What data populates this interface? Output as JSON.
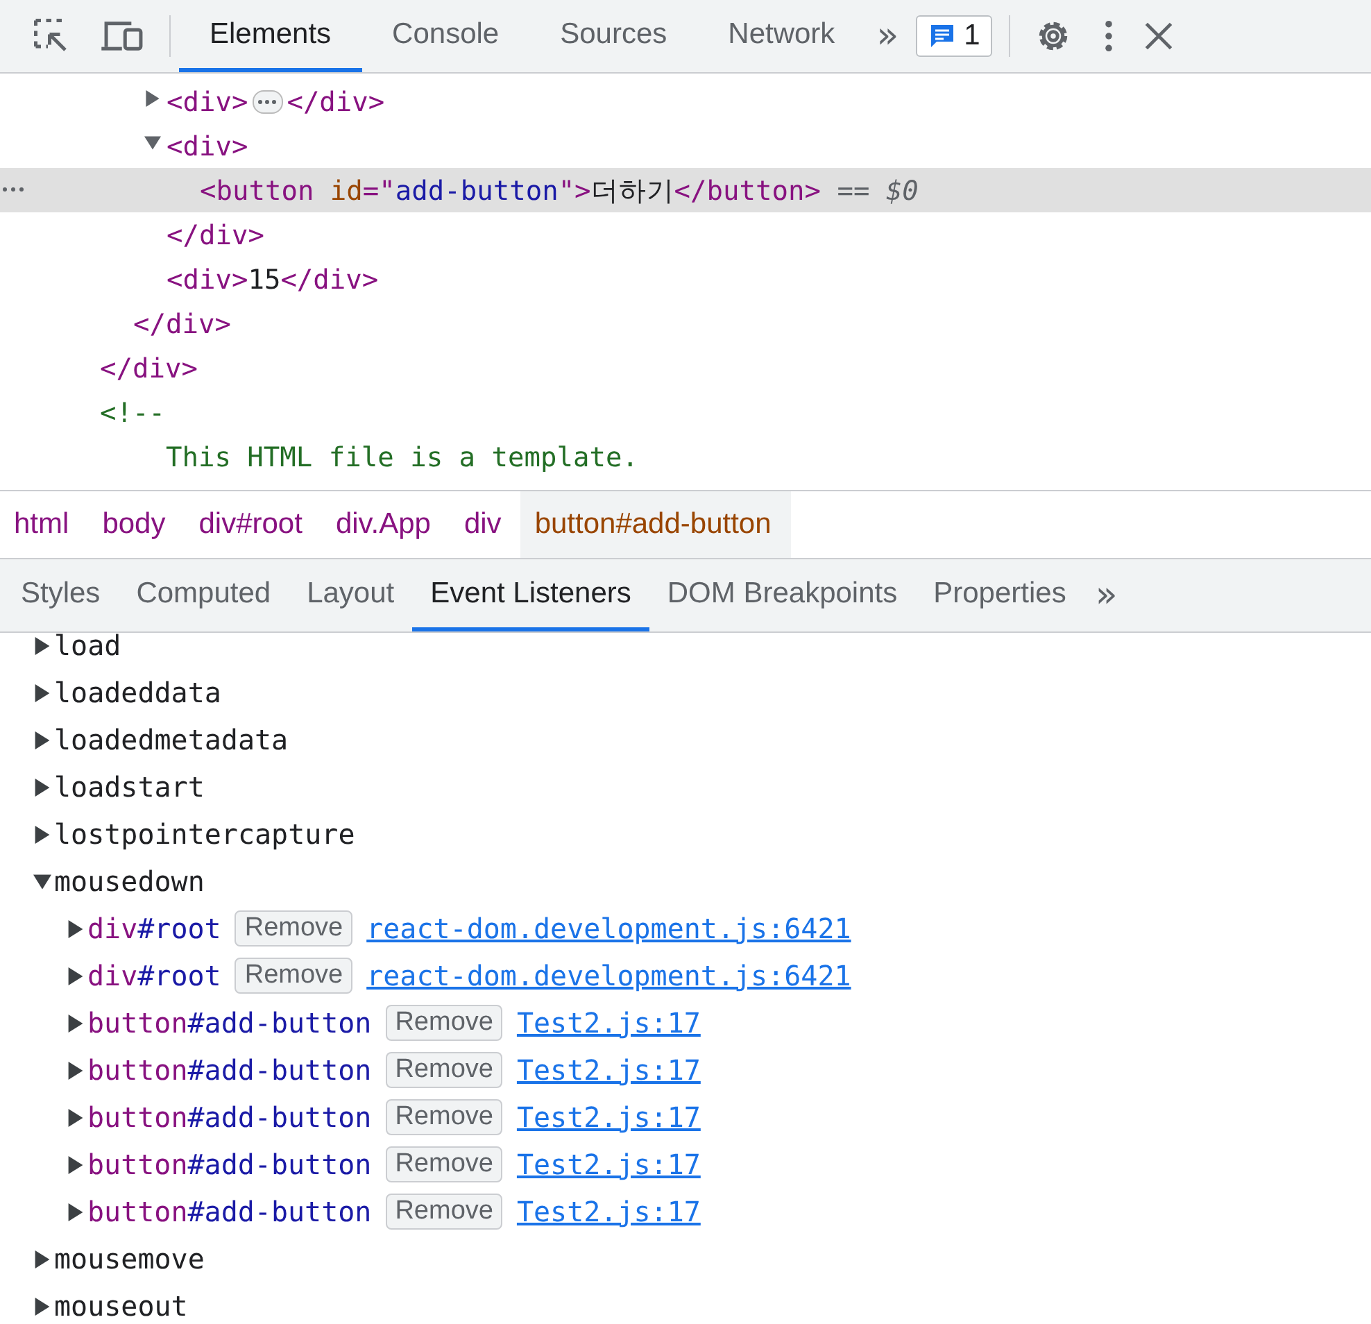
{
  "toolbar": {
    "tabs": [
      {
        "label": "Elements",
        "selected": true
      },
      {
        "label": "Console",
        "selected": false
      },
      {
        "label": "Sources",
        "selected": false
      },
      {
        "label": "Network",
        "selected": false
      }
    ],
    "overflow": "»",
    "issues_count": "1"
  },
  "dom_tree": [
    {
      "close": [
        {
          "kind": "tag",
          "text": "</div>"
        }
      ],
      "children": [
        {
          "close": [
            {
              "kind": "tag",
              "text": "</div>"
            }
          ],
          "children": [
            {
              "expanded": false,
              "selected": false,
              "line": [
                {
                  "kind": "tag",
                  "text": "<div>"
                },
                {
                  "kind": "ellipsis"
                },
                {
                  "kind": "tag",
                  "text": "</div>"
                }
              ]
            },
            {
              "expanded": true,
              "selected": false,
              "line": [
                {
                  "kind": "tag",
                  "text": "<div>"
                }
              ],
              "close": [
                {
                  "kind": "tag",
                  "text": "</div>"
                }
              ],
              "children": [
                {
                  "selected": true,
                  "line": [
                    {
                      "kind": "tag",
                      "text": "<button"
                    },
                    {
                      "kind": "attr",
                      "text": " id"
                    },
                    {
                      "kind": "tag",
                      "text": "=\""
                    },
                    {
                      "kind": "value",
                      "text": "add-button"
                    },
                    {
                      "kind": "tag",
                      "text": "\">"
                    },
                    {
                      "kind": "text",
                      "text": "더하기"
                    },
                    {
                      "kind": "tag",
                      "text": "</button>"
                    },
                    {
                      "kind": "marker",
                      "text": " == "
                    },
                    {
                      "kind": "var",
                      "text": "$0"
                    }
                  ]
                }
              ]
            },
            {
              "selected": false,
              "line": [
                {
                  "kind": "tag",
                  "text": "<div>"
                },
                {
                  "kind": "text",
                  "text": "15"
                },
                {
                  "kind": "tag",
                  "text": "</div>"
                }
              ]
            }
          ]
        }
      ]
    },
    {
      "selected": false,
      "line": [
        {
          "kind": "comment",
          "text": "<!--"
        }
      ],
      "children": [
        {
          "selected": false,
          "line": [
            {
              "kind": "comment",
              "text": "  This HTML file is a template."
            }
          ]
        }
      ]
    }
  ],
  "breadcrumbs": [
    {
      "label": "html",
      "selected": false
    },
    {
      "label": "body",
      "selected": false
    },
    {
      "label": "div#root",
      "selected": false
    },
    {
      "label": "div.App",
      "selected": false
    },
    {
      "label": "div",
      "selected": false
    },
    {
      "label": "button#add-button",
      "selected": true
    }
  ],
  "sub_tabs": [
    {
      "label": "Styles",
      "selected": false
    },
    {
      "label": "Computed",
      "selected": false
    },
    {
      "label": "Layout",
      "selected": false
    },
    {
      "label": "Event Listeners",
      "selected": true
    },
    {
      "label": "DOM Breakpoints",
      "selected": false
    },
    {
      "label": "Properties",
      "selected": false
    }
  ],
  "sub_overflow": "»",
  "events": [
    {
      "name": "load",
      "expanded": false
    },
    {
      "name": "loadeddata",
      "expanded": false
    },
    {
      "name": "loadedmetadata",
      "expanded": false
    },
    {
      "name": "loadstart",
      "expanded": false
    },
    {
      "name": "lostpointercapture",
      "expanded": false
    },
    {
      "name": "mousedown",
      "expanded": true,
      "listeners": [
        {
          "tag": "div",
          "id": "#root",
          "button": "Remove",
          "source": "react-dom.development.js:6421"
        },
        {
          "tag": "div",
          "id": "#root",
          "button": "Remove",
          "source": "react-dom.development.js:6421"
        },
        {
          "tag": "button",
          "id": "#add-button",
          "button": "Remove",
          "source": "Test2.js:17"
        },
        {
          "tag": "button",
          "id": "#add-button",
          "button": "Remove",
          "source": "Test2.js:17"
        },
        {
          "tag": "button",
          "id": "#add-button",
          "button": "Remove",
          "source": "Test2.js:17"
        },
        {
          "tag": "button",
          "id": "#add-button",
          "button": "Remove",
          "source": "Test2.js:17"
        },
        {
          "tag": "button",
          "id": "#add-button",
          "button": "Remove",
          "source": "Test2.js:17"
        }
      ]
    },
    {
      "name": "mousemove",
      "expanded": false
    },
    {
      "name": "mouseout",
      "expanded": false
    }
  ]
}
